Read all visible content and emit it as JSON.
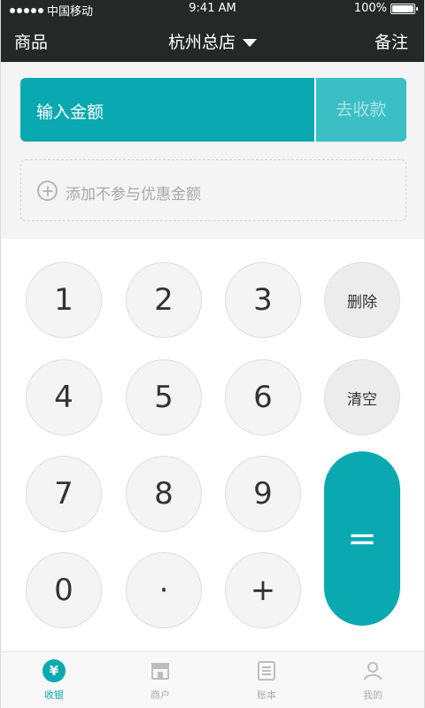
{
  "status_bar": {
    "carrier": "中国移动",
    "time": "9:41 AM",
    "battery": "100%"
  },
  "nav": {
    "left": "商品",
    "title": "杭州总店",
    "right": "备注"
  },
  "amount": {
    "placeholder": "输入金额",
    "collect_label": "去收款"
  },
  "extra": {
    "label": "添加不参与优惠金额"
  },
  "keypad": {
    "k1": "1",
    "k2": "2",
    "k3": "3",
    "delete": "删除",
    "k4": "4",
    "k5": "5",
    "k6": "6",
    "clear": "清空",
    "k7": "7",
    "k8": "8",
    "k9": "9",
    "k0": "0",
    "dot": "·",
    "plus": "+",
    "equals": "="
  },
  "tabs": [
    {
      "label": "收银",
      "icon": "yen-icon",
      "active": true
    },
    {
      "label": "商户",
      "icon": "store-icon",
      "active": false
    },
    {
      "label": "账本",
      "icon": "ledger-icon",
      "active": false
    },
    {
      "label": "我的",
      "icon": "profile-icon",
      "active": false
    }
  ],
  "colors": {
    "accent": "#0aa9b1",
    "nav_bg": "#262827",
    "input_bg": "#f4f4f4"
  }
}
